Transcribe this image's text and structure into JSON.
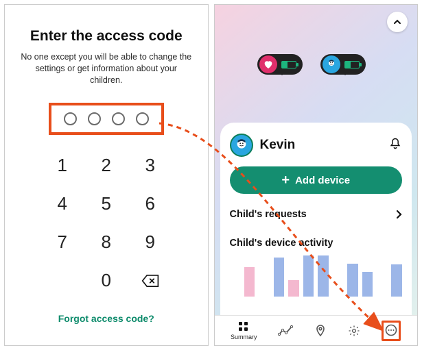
{
  "left_screen": {
    "title": "Enter the access code",
    "subtitle": "No one except you will be able to change the settings or get information about your children.",
    "keypad": {
      "k1": "1",
      "k2": "2",
      "k3": "3",
      "k4": "4",
      "k5": "5",
      "k6": "6",
      "k7": "7",
      "k8": "8",
      "k9": "9",
      "k0": "0"
    },
    "forgot_label": "Forgot access code?"
  },
  "right_screen": {
    "map_fab_icon": "chevron-up",
    "badges": [
      {
        "avatar": "heart",
        "battery_level": 0.35
      },
      {
        "avatar": "face",
        "battery_level": 0.35
      }
    ],
    "child_name": "Kevin",
    "notifications_icon": "bell",
    "add_device_label": "Add device",
    "requests_label": "Child's requests",
    "activity_label": "Child's device activity",
    "navbar": {
      "summary_label": "Summary"
    }
  },
  "annotation": {
    "highlight_code_input": true,
    "highlight_more_nav": true,
    "arrow_color": "#e84e1b"
  }
}
